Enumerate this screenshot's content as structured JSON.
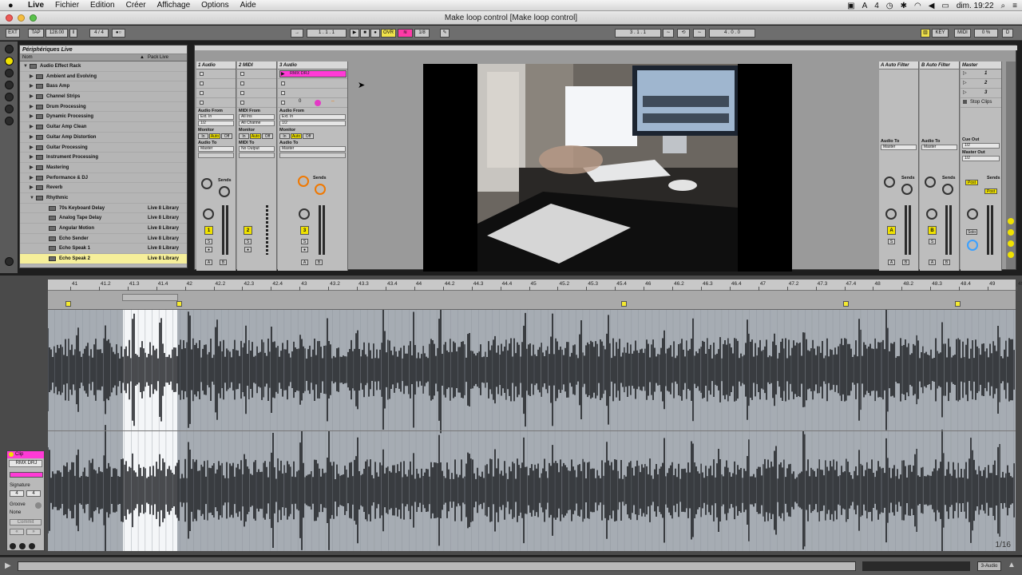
{
  "menubar": {
    "app_name": "Live",
    "items": [
      "Fichier",
      "Edition",
      "Créer",
      "Affichage",
      "Options",
      "Aide"
    ],
    "clock": "dim. 19:22",
    "badge": "4"
  },
  "window": {
    "title": "Make loop control  [Make loop control]"
  },
  "transport": {
    "ext": "EXT",
    "tap": "TAP",
    "tempo": "128.00",
    "signature": "4 / 4",
    "position": "1 . 1 . 1",
    "ovr": "OVR",
    "quantize": "1/8",
    "loop_start": "3 . 1 . 1",
    "loop_length": "4 . 0 . 0",
    "key": "KEY",
    "midi": "MIDI",
    "cpu": "0 %",
    "cpu_meter": "D"
  },
  "browser": {
    "title": "Périphériques Live",
    "col_name": "Nom",
    "col_pack": "Pack Live",
    "items": [
      {
        "label": "Audio Effect Rack",
        "pack": "",
        "level": 0
      },
      {
        "label": "Ambient and Evolving",
        "pack": "",
        "level": 1
      },
      {
        "label": "Bass Amp",
        "pack": "",
        "level": 1
      },
      {
        "label": "Channel Strips",
        "pack": "",
        "level": 1
      },
      {
        "label": "Drum Processing",
        "pack": "",
        "level": 1
      },
      {
        "label": "Dynamic Processing",
        "pack": "",
        "level": 1
      },
      {
        "label": "Guitar Amp Clean",
        "pack": "",
        "level": 1
      },
      {
        "label": "Guitar Amp Distortion",
        "pack": "",
        "level": 1
      },
      {
        "label": "Guitar Processing",
        "pack": "",
        "level": 1
      },
      {
        "label": "Instrument Processing",
        "pack": "",
        "level": 1
      },
      {
        "label": "Mastering",
        "pack": "",
        "level": 1
      },
      {
        "label": "Performance & DJ",
        "pack": "",
        "level": 1
      },
      {
        "label": "Reverb",
        "pack": "",
        "level": 1
      },
      {
        "label": "Rhythmic",
        "pack": "",
        "level": 1
      },
      {
        "label": "70s Keyboard Delay",
        "pack": "Live 8 Library",
        "level": 2
      },
      {
        "label": "Analog Tape Delay",
        "pack": "Live 8 Library",
        "level": 2
      },
      {
        "label": "Angular Motion",
        "pack": "Live 8 Library",
        "level": 2
      },
      {
        "label": "Echo Sender",
        "pack": "Live 8 Library",
        "level": 2
      },
      {
        "label": "Echo Speak 1",
        "pack": "Live 8 Library",
        "level": 2
      },
      {
        "label": "Echo Speak 2",
        "pack": "Live 8 Library",
        "level": 2
      }
    ]
  },
  "tracks": [
    {
      "name": "1 Audio",
      "from_label": "Audio From",
      "from": "Ext. In",
      "channel": "1/2",
      "monitor_label": "Monitor",
      "in": "In",
      "auto": "Auto",
      "off": "Off",
      "to_label": "Audio To",
      "to": "Master",
      "number": "1"
    },
    {
      "name": "2 MIDI",
      "from_label": "MIDI From",
      "from": "All Ins",
      "channel": "All Channe",
      "monitor_label": "Monitor",
      "in": "In",
      "auto": "Auto",
      "off": "Off",
      "to_label": "MIDI To",
      "to": "No Output",
      "number": "2"
    },
    {
      "name": "3 Audio",
      "from_label": "Audio From",
      "from": "Ext. In",
      "channel": "1/2",
      "monitor_label": "Monitor",
      "in": "In",
      "auto": "Auto",
      "off": "Off",
      "to_label": "Audio To",
      "to": "Master",
      "number": "3"
    }
  ],
  "clip_slot": {
    "name": "RMX DRJ",
    "value": "0"
  },
  "sends_label": "Sends",
  "knob_a": "A",
  "knob_b": "B",
  "solo": "S",
  "returns": [
    {
      "name": "A Auto Filter",
      "to_label": "Audio To",
      "to": "Master",
      "letter": "A"
    },
    {
      "name": "B Auto Filter",
      "to_label": "Audio To",
      "to": "Master",
      "letter": "B"
    }
  ],
  "master": {
    "name": "Master",
    "scenes": [
      "1",
      "2",
      "3"
    ],
    "stop_clips": "Stop Clips",
    "cue_out_label": "Cue Out",
    "cue_out": "1/2",
    "master_out_label": "Master Out",
    "master_out": "1/2",
    "post": "Post",
    "solo": "Solo"
  },
  "ruler": [
    "41",
    "41.2",
    "41.3",
    "41.4",
    "42",
    "42.2",
    "42.3",
    "42.4",
    "43",
    "43.2",
    "43.3",
    "43.4",
    "44",
    "44.2",
    "44.3",
    "44.4",
    "45",
    "45.2",
    "45.3",
    "45.4",
    "46",
    "46.2",
    "46.3",
    "46.4",
    "47",
    "47.2",
    "47.3",
    "47.4",
    "48",
    "48.2",
    "48.3",
    "48.4",
    "49",
    "49.2"
  ],
  "clip": {
    "header": "Clip",
    "name": "RMX DRJ",
    "signature_label": "Signature",
    "sig_num": "4",
    "sig_den": "4",
    "groove_label": "Groove",
    "groove": "None",
    "commit": "Commit"
  },
  "grid": "1/16",
  "status": {
    "track": "3-Audio"
  }
}
